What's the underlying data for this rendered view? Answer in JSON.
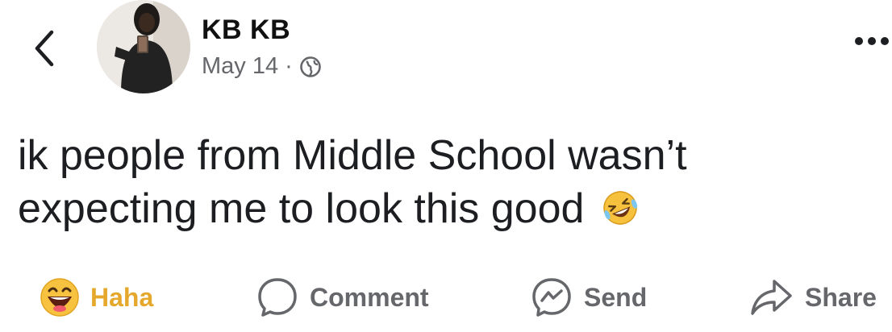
{
  "post": {
    "author": "KB KB",
    "date": "May 14",
    "separator": "·",
    "privacy_icon": "globe-icon",
    "text_line1": "ik people from Middle School wasn’t",
    "text_line2": "expecting me to look this good",
    "emoji": "rolling-on-floor-laughing-emoji"
  },
  "actions": {
    "reaction_label": "Haha",
    "comment_label": "Comment",
    "send_label": "Send",
    "share_label": "Share"
  },
  "colors": {
    "haha": "#e5a82d",
    "muted": "#65676b",
    "text": "#1c1e21"
  }
}
